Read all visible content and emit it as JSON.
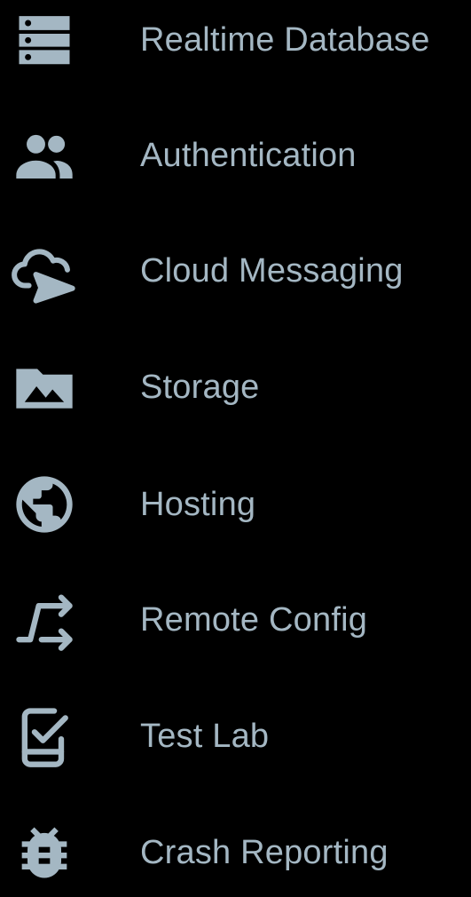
{
  "theme": {
    "background": "#000000",
    "icon_color": "#a4b7c3",
    "text_color": "#a4b7c3"
  },
  "nav": {
    "items": [
      {
        "label": "Realtime Database",
        "icon": "database-icon"
      },
      {
        "label": "Authentication",
        "icon": "people-icon"
      },
      {
        "label": "Cloud Messaging",
        "icon": "cloud-send-icon"
      },
      {
        "label": "Storage",
        "icon": "photo-folder-icon"
      },
      {
        "label": "Hosting",
        "icon": "globe-icon"
      },
      {
        "label": "Remote Config",
        "icon": "remote-config-icon"
      },
      {
        "label": "Test Lab",
        "icon": "phone-check-icon"
      },
      {
        "label": "Crash Reporting",
        "icon": "bug-icon"
      }
    ]
  }
}
